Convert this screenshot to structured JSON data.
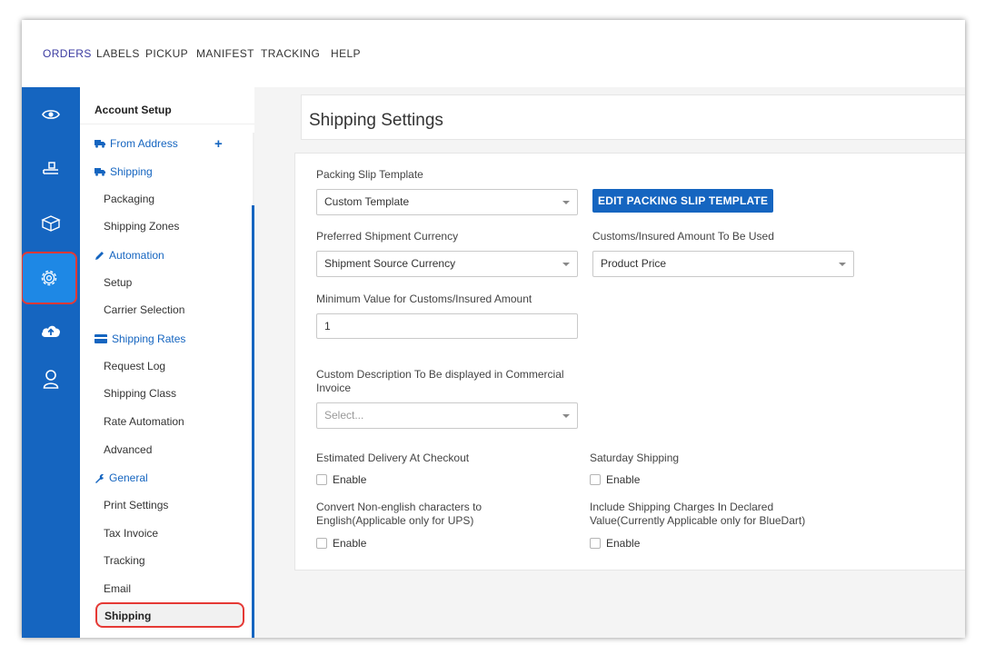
{
  "topnav": {
    "items": [
      {
        "label": "ORDERS",
        "active": true
      },
      {
        "label": "LABELS"
      },
      {
        "label": "PICKUP"
      },
      {
        "label": "MANIFEST"
      },
      {
        "label": "TRACKING"
      },
      {
        "label": "HELP"
      }
    ]
  },
  "rail": {
    "icons": [
      "eye-icon",
      "ship-box-icon",
      "box-icon",
      "settings-gear-icon",
      "cloud-upload-icon",
      "user-icon"
    ],
    "active": "settings-gear-icon"
  },
  "sidebar": {
    "title": "Account Setup",
    "from_address": "From Address",
    "shipping": "Shipping",
    "packaging": "Packaging",
    "shipping_zones": "Shipping Zones",
    "automation": "Automation",
    "setup": "Setup",
    "carrier_selection": "Carrier Selection",
    "shipping_rates": "Shipping Rates",
    "request_log": "Request Log",
    "shipping_class": "Shipping Class",
    "rate_automation": "Rate Automation",
    "advanced": "Advanced",
    "general": "General",
    "print_settings": "Print Settings",
    "tax_invoice": "Tax Invoice",
    "tracking": "Tracking",
    "email": "Email",
    "shipping_current": "Shipping"
  },
  "page": {
    "title": "Shipping Settings",
    "packing_slip_label": "Packing Slip Template",
    "packing_slip_value": "Custom Template",
    "edit_button": "EDIT PACKING SLIP TEMPLATE",
    "currency_label": "Preferred Shipment Currency",
    "currency_value": "Shipment Source Currency",
    "customs_label": "Customs/Insured Amount To Be Used",
    "customs_value": "Product Price",
    "min_value_label": "Minimum Value for Customs/Insured Amount",
    "min_value": "1",
    "custom_desc_label_1": "Custom Description To Be displayed in Commercial",
    "custom_desc_label_2": "Invoice",
    "custom_desc_placeholder": "Select...",
    "est_delivery_label": "Estimated Delivery At Checkout",
    "saturday_label": "Saturday Shipping",
    "convert_label_1": "Convert Non-english characters to",
    "convert_label_2": "English(Applicable only for UPS)",
    "include_label_1": "Include Shipping Charges In Declared",
    "include_label_2": "Value(Currently Applicable only for BlueDart)",
    "enable": "Enable"
  },
  "colors": {
    "brand_blue": "#1565c0",
    "active_rail": "#1e88e5",
    "highlight_red": "#e53935"
  }
}
